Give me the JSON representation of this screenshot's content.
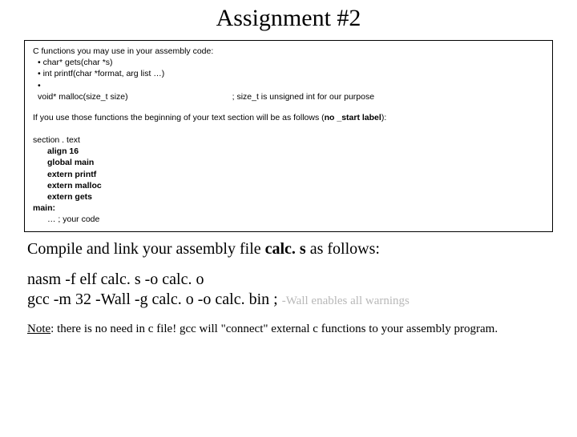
{
  "title": "Assignment #2",
  "box": {
    "intro": "C functions you may use in your assembly code:",
    "b1": "char* gets(char *s)",
    "b2": "int printf(char *format, arg list …)",
    "b3": "void* malloc(size_t size)",
    "b3_comment": "; size_t is unsigned int for our purpose",
    "use_pre": "If you use those functions the beginning of your text section will be as follows (",
    "use_bold": "no _start label",
    "use_post": "):",
    "c1": "section . text",
    "c2": "align 16",
    "c3": "global main",
    "c4": "extern printf",
    "c5": "extern malloc",
    "c6": "extern gets",
    "c7": "main:",
    "c8": "… ; your code"
  },
  "compile": {
    "pre": "Compile and link your assembly file ",
    "file": "calc. s",
    "post": " as follows:"
  },
  "cmd1": "nasm -f elf calc. s -o calc. o",
  "cmd2_a": "gcc -m 32 -Wall -g calc. o -o calc. bin   ; ",
  "cmd2_b": "-Wall enables all warnings",
  "note": {
    "label": "Note",
    "rest": ": there is no need in c file! gcc will \"connect\" external c functions to your assembly program."
  }
}
